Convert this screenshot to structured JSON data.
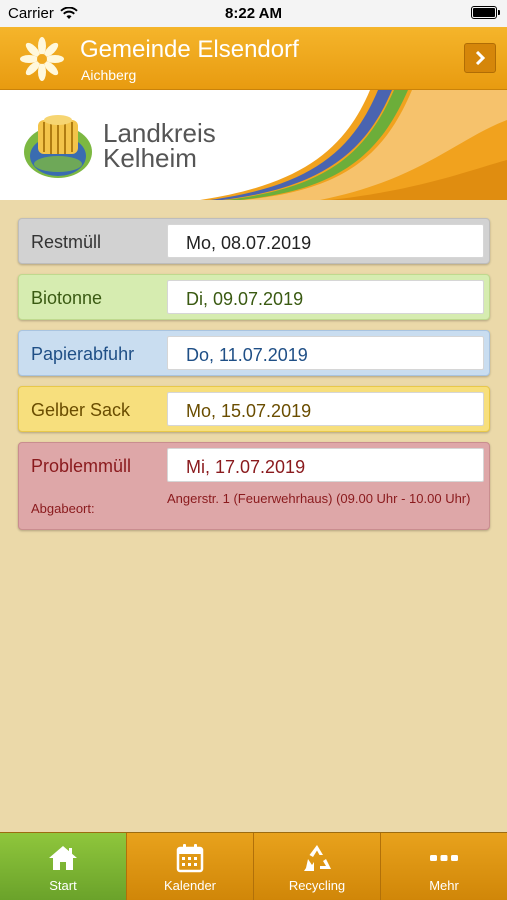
{
  "status_bar": {
    "carrier": "Carrier",
    "time": "8:22 AM"
  },
  "header": {
    "title": "Gemeinde Elsendorf",
    "subtitle": "Aichberg"
  },
  "banner": {
    "line1": "Landkreis",
    "line2": "Kelheim"
  },
  "items": [
    {
      "label": "Restmüll",
      "date": "Mo, 08.07.2019"
    },
    {
      "label": "Biotonne",
      "date": "Di,  09.07.2019"
    },
    {
      "label": "Papierabfuhr",
      "date": "Do, 11.07.2019"
    },
    {
      "label": "Gelber Sack",
      "date": "Mo, 15.07.2019"
    },
    {
      "label": "Problemmüll",
      "date": "Mi,  17.07.2019",
      "sublabel": "Abgabeort:",
      "place": "Angerstr. 1 (Feuerwehrhaus) (09.00 Uhr - 10.00 Uhr)"
    }
  ],
  "tabs": [
    {
      "label": "Start",
      "icon": "home-icon"
    },
    {
      "label": "Kalender",
      "icon": "calendar-icon"
    },
    {
      "label": "Recycling",
      "icon": "recycle-icon"
    },
    {
      "label": "Mehr",
      "icon": "more-icon"
    }
  ],
  "colors": {
    "header": "#f0a920",
    "background": "#ebd9a9",
    "tab_active": "#7eb534",
    "tab": "#e09414"
  }
}
